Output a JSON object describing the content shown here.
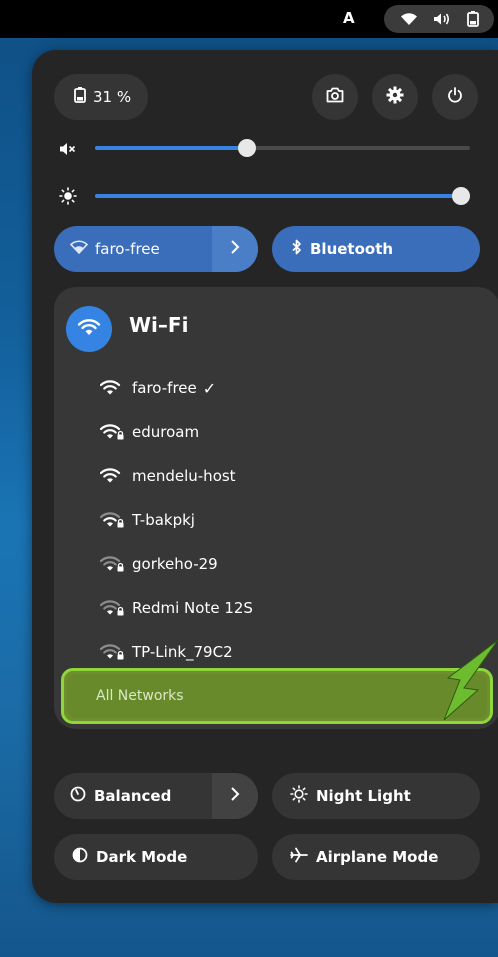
{
  "topbar": {
    "keyboard_indicator": "A",
    "icons": [
      "wifi-icon",
      "volume-icon",
      "battery-icon"
    ]
  },
  "quick_settings": {
    "battery_label": "31 %",
    "header_icons": [
      "screenshot-icon",
      "settings-icon",
      "power-icon"
    ],
    "volume_slider": {
      "icon": "volume-muted-icon",
      "level": 0.4
    },
    "brightness_slider": {
      "icon": "brightness-icon",
      "level": 1.0
    },
    "wifi_toggle_label": "faro-free",
    "bluetooth_toggle_label": "Bluetooth",
    "wifi_menu": {
      "title": "Wi–Fi",
      "networks": [
        {
          "name": "faro-free",
          "connected": true,
          "secured": false,
          "strength": "strong"
        },
        {
          "name": "eduroam",
          "connected": false,
          "secured": true,
          "strength": "strong"
        },
        {
          "name": "mendelu-host",
          "connected": false,
          "secured": false,
          "strength": "strong"
        },
        {
          "name": "T-bakpkj",
          "connected": false,
          "secured": true,
          "strength": "medium"
        },
        {
          "name": "gorkeho-29",
          "connected": false,
          "secured": true,
          "strength": "weak"
        },
        {
          "name": "Redmi Note 12S",
          "connected": false,
          "secured": true,
          "strength": "weak"
        },
        {
          "name": "TP-Link_79C2",
          "connected": false,
          "secured": true,
          "strength": "weak"
        }
      ],
      "connected_mark": "✓",
      "all_networks_label": "All Networks"
    },
    "power_mode_label": "Balanced",
    "night_light_label": "Night Light",
    "dark_mode_label": "Dark Mode",
    "airplane_mode_label": "Airplane Mode"
  },
  "colors": {
    "accent": "#3584e4",
    "toggle_active": "#3a6dba",
    "highlight": "#8fd63a"
  }
}
